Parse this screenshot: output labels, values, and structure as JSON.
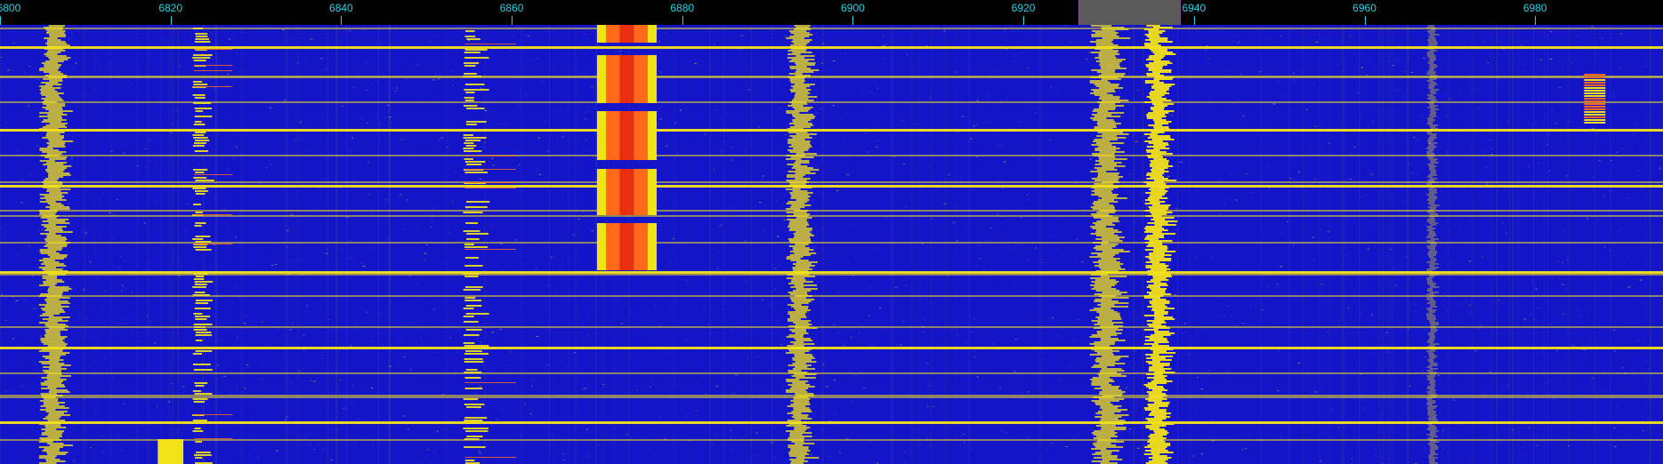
{
  "frequency_scale": {
    "unit": "kHz",
    "min": 6800,
    "max": 6995,
    "ticks": [
      "6800",
      "6820",
      "6840",
      "6860",
      "6880",
      "6900",
      "6920",
      "6940",
      "6960",
      "6980"
    ]
  },
  "passband": {
    "start": 6926.5,
    "end": 6938.5
  },
  "waterfall": {
    "colors": {
      "background": "#1414c8",
      "noise": "#b8a850",
      "signal": "#f2e21a",
      "strong": "#ff6a1a",
      "peak": "#e52a10"
    },
    "signals": [
      {
        "name": "signal-6807",
        "freq": 6806.5,
        "width": 2.6,
        "type": "continuous",
        "level": "medium"
      },
      {
        "name": "signal-6823",
        "freq": 6823.5,
        "width": 1.5,
        "type": "intermittent",
        "level": "medium"
      },
      {
        "name": "signal-6823-bottom-burst",
        "freq": 6820.0,
        "width": 3.0,
        "type": "burst",
        "level": "high"
      },
      {
        "name": "signal-6855",
        "freq": 6855.5,
        "width": 2.0,
        "type": "intermittent",
        "level": "medium"
      },
      {
        "name": "signal-6873-strong",
        "freq": 6873.5,
        "width": 7.0,
        "type": "pulsed",
        "level": "very-high"
      },
      {
        "name": "signal-6894",
        "freq": 6894.0,
        "width": 2.5,
        "type": "continuous",
        "level": "medium"
      },
      {
        "name": "signal-6930",
        "freq": 6930.0,
        "width": 3.0,
        "type": "continuous",
        "level": "medium"
      },
      {
        "name": "signal-6936",
        "freq": 6936.0,
        "width": 2.5,
        "type": "continuous",
        "level": "high"
      },
      {
        "name": "signal-6968",
        "freq": 6968.0,
        "width": 1.0,
        "type": "continuous",
        "level": "low"
      },
      {
        "name": "signal-6987",
        "freq": 6987.0,
        "width": 2.5,
        "type": "burst",
        "level": "high"
      }
    ]
  }
}
